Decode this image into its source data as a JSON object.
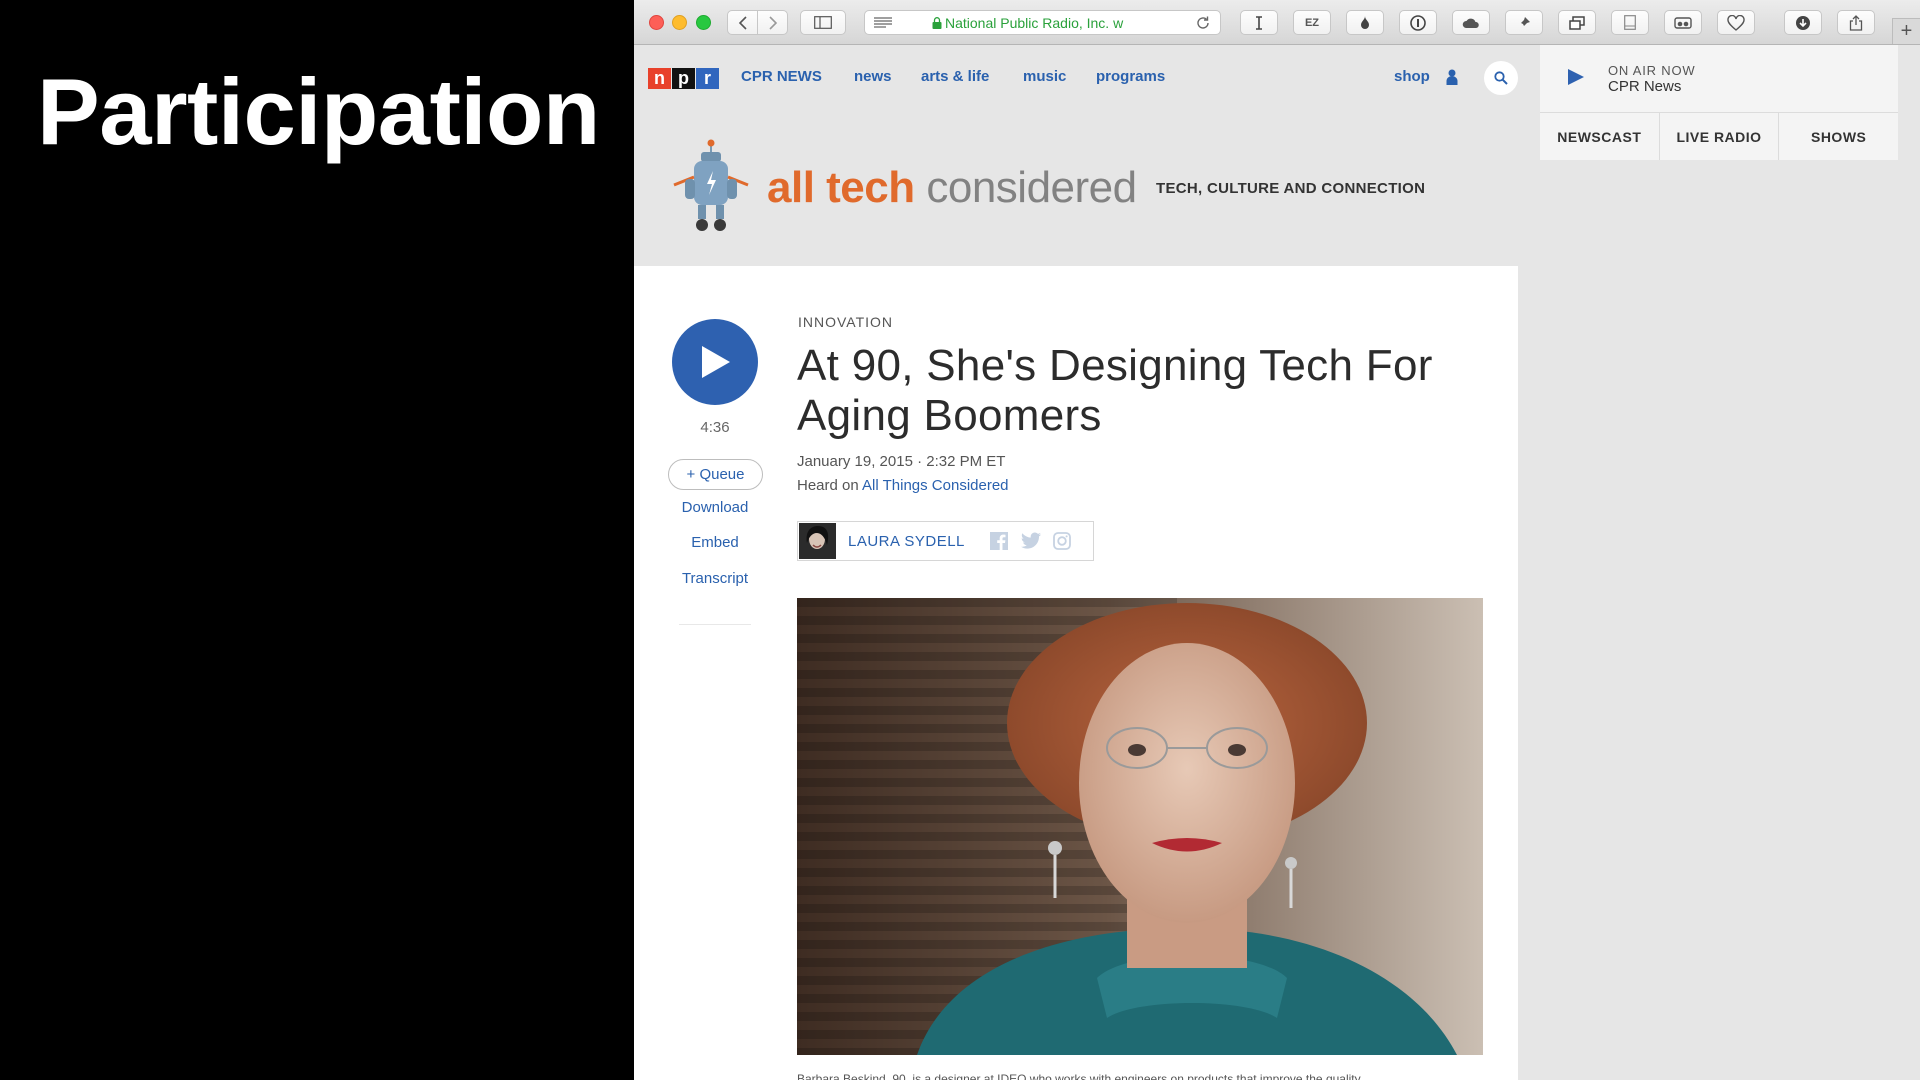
{
  "slide": {
    "title": "Participation"
  },
  "browser": {
    "url_text": "National Public Radio, Inc. w",
    "new_tab_label": "+"
  },
  "nav": {
    "logo": [
      "n",
      "p",
      "r"
    ],
    "station_link": "CPR NEWS",
    "links": [
      "news",
      "arts & life",
      "music",
      "programs"
    ],
    "shop": "shop"
  },
  "banner": {
    "title_part1": "all tech",
    "title_part2": "considered",
    "tagline": "TECH, CULTURE AND CONNECTION"
  },
  "article": {
    "kicker": "INNOVATION",
    "headline": "At 90, She's Designing Tech For Aging Boomers",
    "dateline": "January 19, 2015 · 2:32 PM ET",
    "heard_prefix": "Heard on ",
    "heard_show": "All Things Considered",
    "author": "LAURA SYDELL",
    "duration": "4:36",
    "queue_label": "+ Queue",
    "side_links": [
      "Download",
      "Embed",
      "Transcript"
    ],
    "caption": "Barbara Beskind, 90, is a designer at IDEO who works with engineers on products that improve the quality"
  },
  "onair": {
    "label": "ON AIR NOW",
    "station": "CPR News",
    "tabs": [
      "NEWSCAST",
      "LIVE RADIO",
      "SHOWS"
    ]
  },
  "colors": {
    "npr_red": "#e8412b",
    "npr_blue": "#3066be",
    "link_blue": "#2a61ae",
    "banner_orange": "#e06a2c"
  }
}
